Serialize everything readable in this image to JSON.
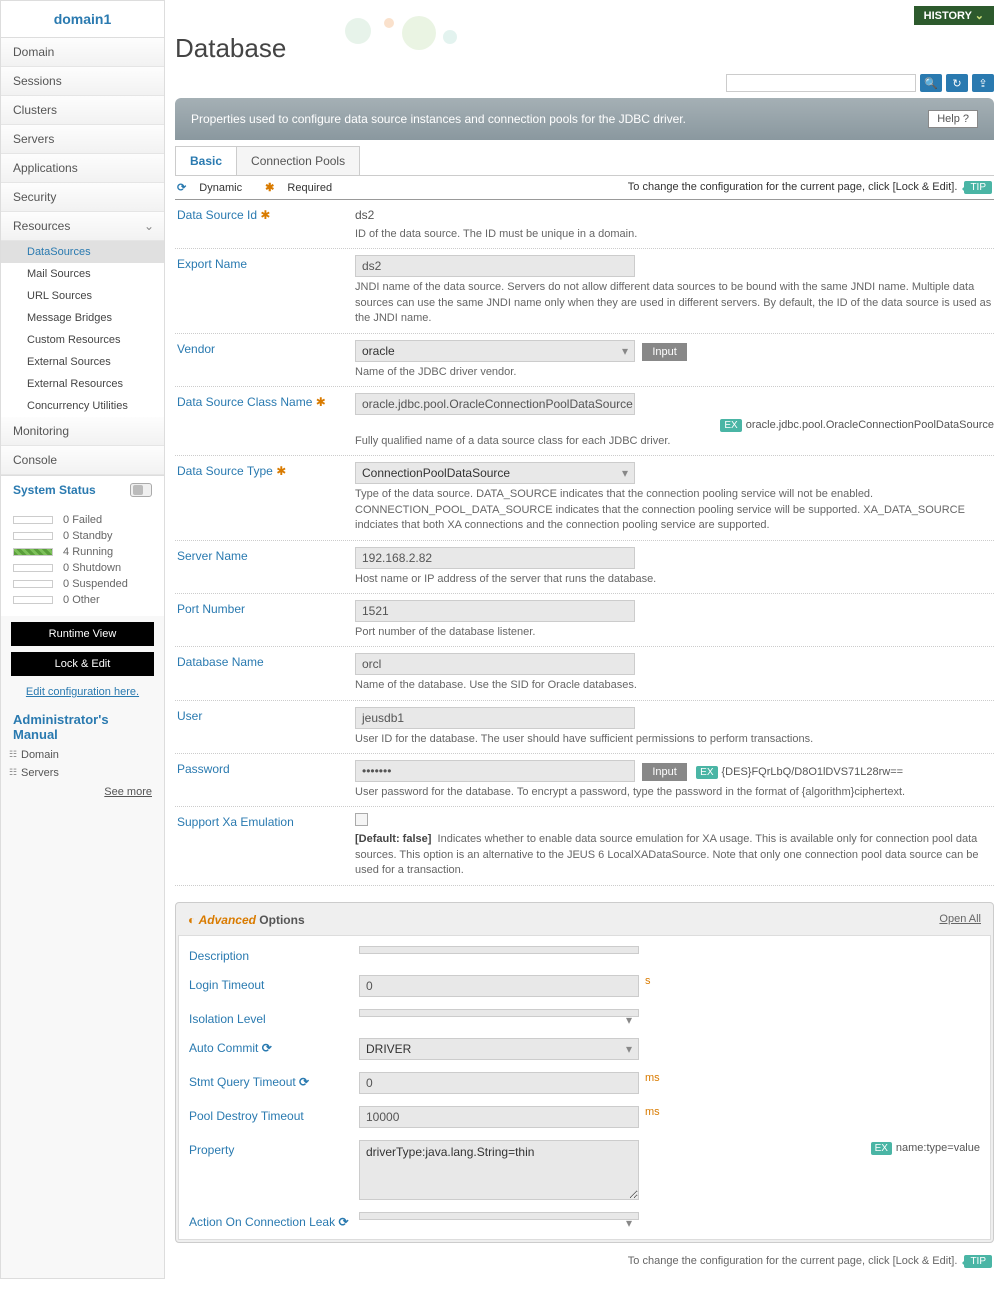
{
  "sidebar": {
    "title": "domain1",
    "nav": [
      "Domain",
      "Sessions",
      "Clusters",
      "Servers",
      "Applications",
      "Security",
      "Resources"
    ],
    "resources_sub": [
      "DataSources",
      "Mail Sources",
      "URL Sources",
      "Message Bridges",
      "Custom Resources",
      "External Sources",
      "External Resources",
      "Concurrency Utilities"
    ],
    "monitoring": "Monitoring",
    "console": "Console",
    "system_status_title": "System Status",
    "status": [
      {
        "count": "0",
        "label": "Failed"
      },
      {
        "count": "0",
        "label": "Standby"
      },
      {
        "count": "4",
        "label": "Running"
      },
      {
        "count": "0",
        "label": "Shutdown"
      },
      {
        "count": "0",
        "label": "Suspended"
      },
      {
        "count": "0",
        "label": "Other"
      }
    ],
    "btn_runtime": "Runtime View",
    "btn_lock": "Lock & Edit",
    "link_edit": "Edit configuration here.",
    "admin_title": "Administrator's Manual",
    "admin_items": [
      "Domain",
      "Servers"
    ],
    "see_more": "See more"
  },
  "header": {
    "history": "HISTORY",
    "page_title": "Database"
  },
  "banner": {
    "text": "Properties used to configure data source instances and connection pools for the JDBC driver.",
    "help": "Help ?"
  },
  "tabs": [
    "Basic",
    "Connection Pools"
  ],
  "legend": {
    "dynamic": "Dynamic",
    "required": "Required",
    "tip_text": "To change the configuration for the current page, click [Lock & Edit].",
    "tip": "TIP"
  },
  "form": {
    "data_source_id": {
      "label": "Data Source Id",
      "value": "ds2",
      "help": "ID of the data source. The ID must be unique in a domain."
    },
    "export_name": {
      "label": "Export Name",
      "value": "ds2",
      "help": "JNDI name of the data source. Servers do not allow different data sources to be bound with the same JNDI name. Multiple data sources can use the same JNDI name only when they are used in different servers. By default, the ID of the data source is used as the JNDI name."
    },
    "vendor": {
      "label": "Vendor",
      "value": "oracle",
      "input_btn": "Input",
      "help": "Name of the JDBC driver vendor."
    },
    "ds_class": {
      "label": "Data Source Class Name",
      "value": "oracle.jdbc.pool.OracleConnectionPoolDataSource",
      "ex": "oracle.jdbc.pool.OracleConnectionPoolDataSource",
      "help": "Fully qualified name of a data source class for each JDBC driver."
    },
    "ds_type": {
      "label": "Data Source Type",
      "value": "ConnectionPoolDataSource",
      "help": "Type of the data source. DATA_SOURCE indicates that the connection pooling service will not be enabled. CONNECTION_POOL_DATA_SOURCE indicates that the connection pooling service will be supported. XA_DATA_SOURCE indciates that both XA connections and the connection pooling service are supported."
    },
    "server_name": {
      "label": "Server Name",
      "value": "192.168.2.82",
      "help": "Host name or IP address of the server that runs the database."
    },
    "port": {
      "label": "Port Number",
      "value": "1521",
      "help": "Port number of the database listener."
    },
    "db_name": {
      "label": "Database Name",
      "value": "orcl",
      "help": "Name of the database. Use the SID for Oracle databases."
    },
    "user": {
      "label": "User",
      "value": "jeusdb1",
      "help": "User ID for the database. The user should have sufficient permissions to perform transactions."
    },
    "password": {
      "label": "Password",
      "value": "•••••••",
      "input_btn": "Input",
      "ex": "{DES}FQrLbQ/D8O1lDVS71L28rw==",
      "help": "User password for the database. To encrypt a password, type the password in the format of {algorithm}ciphertext."
    },
    "xa": {
      "label": "Support Xa Emulation",
      "default": "[Default: false]",
      "help": "Indicates whether to enable data source emulation for XA usage. This is available only for connection pool data sources. This option is an alternative to the JEUS 6 LocalXADataSource. Note that only one connection pool data source can be used for a transaction."
    }
  },
  "advanced": {
    "title_a": "Advanced",
    "title_b": "Options",
    "open_all": "Open All",
    "desc": {
      "label": "Description",
      "value": ""
    },
    "login": {
      "label": "Login Timeout",
      "value": "0",
      "unit": "s"
    },
    "isolation": {
      "label": "Isolation Level",
      "value": ""
    },
    "autocommit": {
      "label": "Auto Commit",
      "value": "DRIVER"
    },
    "stmt": {
      "label": "Stmt Query Timeout",
      "value": "0",
      "unit": "ms"
    },
    "pool": {
      "label": "Pool Destroy Timeout",
      "value": "10000",
      "unit": "ms"
    },
    "property": {
      "label": "Property",
      "value": "driverType:java.lang.String=thin",
      "ex": "name:type=value"
    },
    "action": {
      "label": "Action On Connection Leak",
      "value": ""
    }
  },
  "ex_label": "EX"
}
